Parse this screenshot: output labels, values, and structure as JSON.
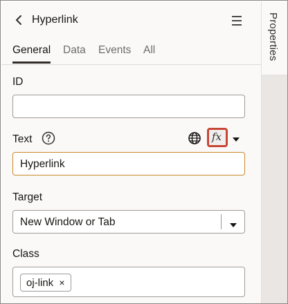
{
  "header": {
    "title": "Hyperlink"
  },
  "tabs": [
    {
      "label": "General"
    },
    {
      "label": "Data"
    },
    {
      "label": "Events"
    },
    {
      "label": "All"
    }
  ],
  "fields": {
    "id": {
      "label": "ID",
      "value": ""
    },
    "text": {
      "label": "Text",
      "value": "Hyperlink",
      "fx_label": "fx"
    },
    "target": {
      "label": "Target",
      "value": "New Window or Tab"
    },
    "class": {
      "label": "Class",
      "chips": [
        {
          "label": "oj-link",
          "close": "×"
        }
      ]
    }
  },
  "side_rail": {
    "tab_label": "Properties"
  },
  "colors": {
    "accent_red": "#c74634",
    "focus": "#c8872b",
    "text": "#161513"
  },
  "icons": [
    "back-icon",
    "menu-icon",
    "help-icon",
    "globe-icon",
    "fx-icon",
    "caret-down-icon",
    "close-icon"
  ]
}
